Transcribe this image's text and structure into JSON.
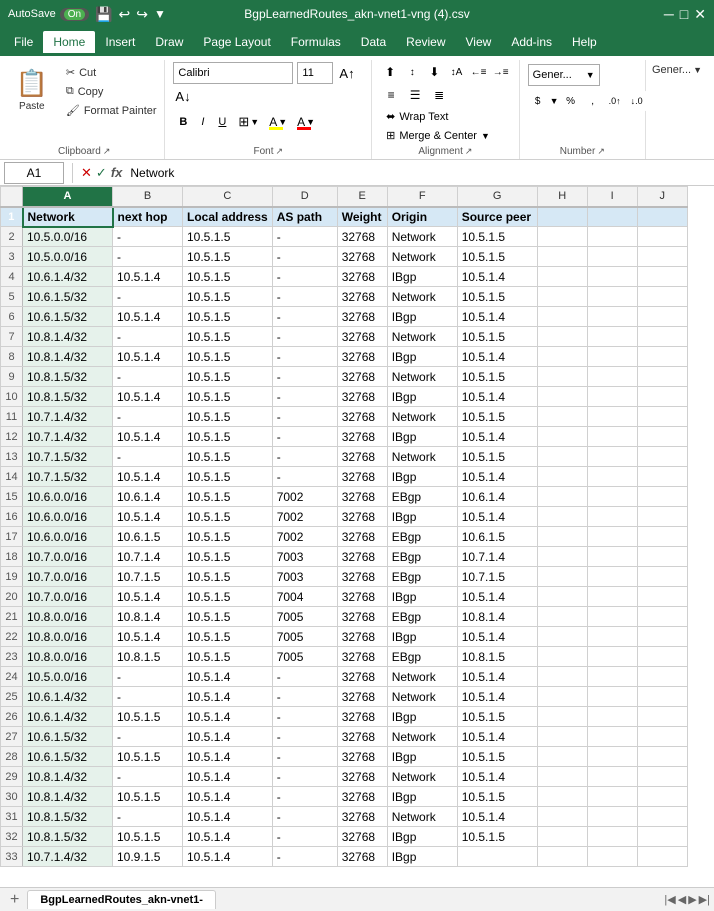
{
  "titleBar": {
    "autosave": "AutoSave",
    "on": "On",
    "title": "BgpLearnedRoutes_akn-vnet1-vng (4).csv",
    "icons": [
      "save",
      "undo",
      "redo",
      "customize"
    ]
  },
  "menuBar": {
    "items": [
      "File",
      "Home",
      "Insert",
      "Draw",
      "Page Layout",
      "Formulas",
      "Data",
      "Review",
      "View",
      "Add-ins",
      "Help"
    ],
    "active": "Home"
  },
  "ribbon": {
    "clipboard": {
      "label": "Clipboard",
      "paste_label": "Paste",
      "cut_label": "Cut",
      "copy_label": "Copy",
      "format_painter_label": "Format Painter"
    },
    "font": {
      "label": "Font",
      "name": "Calibri",
      "size": "11",
      "bold": "B",
      "italic": "I",
      "underline": "U",
      "border_label": "Border",
      "fill_label": "A",
      "fill_color": "#FFFF00",
      "font_color": "#FF0000"
    },
    "alignment": {
      "label": "Alignment",
      "wrap_text": "Wrap Text",
      "merge_center": "Merge & Center"
    },
    "number": {
      "label": "Number",
      "general_label": "Gener..."
    }
  },
  "formulaBar": {
    "cell_ref": "A1",
    "formula_value": "Network"
  },
  "columns": {
    "headers": [
      "",
      "A",
      "B",
      "C",
      "D",
      "E",
      "F",
      "G",
      "H",
      "I",
      "J"
    ],
    "widths": [
      22,
      90,
      70,
      80,
      70,
      55,
      75,
      80,
      55,
      55,
      55
    ]
  },
  "rows": [
    {
      "row": 1,
      "A": "Network",
      "B": "next hop",
      "C": "Local address",
      "D": "AS path",
      "E": "Weight",
      "F": "Origin",
      "G": "Source peer"
    },
    {
      "row": 2,
      "A": "10.5.0.0/16",
      "B": "-",
      "C": "10.5.1.5",
      "D": "-",
      "E": "32768",
      "F": "Network",
      "G": "10.5.1.5"
    },
    {
      "row": 3,
      "A": "10.5.0.0/16",
      "B": "-",
      "C": "10.5.1.5",
      "D": "-",
      "E": "32768",
      "F": "Network",
      "G": "10.5.1.5"
    },
    {
      "row": 4,
      "A": "10.6.1.4/32",
      "B": "10.5.1.4",
      "C": "10.5.1.5",
      "D": "-",
      "E": "32768",
      "F": "IBgp",
      "G": "10.5.1.4"
    },
    {
      "row": 5,
      "A": "10.6.1.5/32",
      "B": "-",
      "C": "10.5.1.5",
      "D": "-",
      "E": "32768",
      "F": "Network",
      "G": "10.5.1.5"
    },
    {
      "row": 6,
      "A": "10.6.1.5/32",
      "B": "10.5.1.4",
      "C": "10.5.1.5",
      "D": "-",
      "E": "32768",
      "F": "IBgp",
      "G": "10.5.1.4"
    },
    {
      "row": 7,
      "A": "10.8.1.4/32",
      "B": "-",
      "C": "10.5.1.5",
      "D": "-",
      "E": "32768",
      "F": "Network",
      "G": "10.5.1.5"
    },
    {
      "row": 8,
      "A": "10.8.1.4/32",
      "B": "10.5.1.4",
      "C": "10.5.1.5",
      "D": "-",
      "E": "32768",
      "F": "IBgp",
      "G": "10.5.1.4"
    },
    {
      "row": 9,
      "A": "10.8.1.5/32",
      "B": "-",
      "C": "10.5.1.5",
      "D": "-",
      "E": "32768",
      "F": "Network",
      "G": "10.5.1.5"
    },
    {
      "row": 10,
      "A": "10.8.1.5/32",
      "B": "10.5.1.4",
      "C": "10.5.1.5",
      "D": "-",
      "E": "32768",
      "F": "IBgp",
      "G": "10.5.1.4"
    },
    {
      "row": 11,
      "A": "10.7.1.4/32",
      "B": "-",
      "C": "10.5.1.5",
      "D": "-",
      "E": "32768",
      "F": "Network",
      "G": "10.5.1.5"
    },
    {
      "row": 12,
      "A": "10.7.1.4/32",
      "B": "10.5.1.4",
      "C": "10.5.1.5",
      "D": "-",
      "E": "32768",
      "F": "IBgp",
      "G": "10.5.1.4"
    },
    {
      "row": 13,
      "A": "10.7.1.5/32",
      "B": "-",
      "C": "10.5.1.5",
      "D": "-",
      "E": "32768",
      "F": "Network",
      "G": "10.5.1.5"
    },
    {
      "row": 14,
      "A": "10.7.1.5/32",
      "B": "10.5.1.4",
      "C": "10.5.1.5",
      "D": "-",
      "E": "32768",
      "F": "IBgp",
      "G": "10.5.1.4"
    },
    {
      "row": 15,
      "A": "10.6.0.0/16",
      "B": "10.6.1.4",
      "C": "10.5.1.5",
      "D": "7002",
      "E": "32768",
      "F": "EBgp",
      "G": "10.6.1.4"
    },
    {
      "row": 16,
      "A": "10.6.0.0/16",
      "B": "10.5.1.4",
      "C": "10.5.1.5",
      "D": "7002",
      "E": "32768",
      "F": "IBgp",
      "G": "10.5.1.4"
    },
    {
      "row": 17,
      "A": "10.6.0.0/16",
      "B": "10.6.1.5",
      "C": "10.5.1.5",
      "D": "7002",
      "E": "32768",
      "F": "EBgp",
      "G": "10.6.1.5"
    },
    {
      "row": 18,
      "A": "10.7.0.0/16",
      "B": "10.7.1.4",
      "C": "10.5.1.5",
      "D": "7003",
      "E": "32768",
      "F": "EBgp",
      "G": "10.7.1.4"
    },
    {
      "row": 19,
      "A": "10.7.0.0/16",
      "B": "10.7.1.5",
      "C": "10.5.1.5",
      "D": "7003",
      "E": "32768",
      "F": "EBgp",
      "G": "10.7.1.5"
    },
    {
      "row": 20,
      "A": "10.7.0.0/16",
      "B": "10.5.1.4",
      "C": "10.5.1.5",
      "D": "7004",
      "E": "32768",
      "F": "IBgp",
      "G": "10.5.1.4"
    },
    {
      "row": 21,
      "A": "10.8.0.0/16",
      "B": "10.8.1.4",
      "C": "10.5.1.5",
      "D": "7005",
      "E": "32768",
      "F": "EBgp",
      "G": "10.8.1.4"
    },
    {
      "row": 22,
      "A": "10.8.0.0/16",
      "B": "10.5.1.4",
      "C": "10.5.1.5",
      "D": "7005",
      "E": "32768",
      "F": "IBgp",
      "G": "10.5.1.4"
    },
    {
      "row": 23,
      "A": "10.8.0.0/16",
      "B": "10.8.1.5",
      "C": "10.5.1.5",
      "D": "7005",
      "E": "32768",
      "F": "EBgp",
      "G": "10.8.1.5"
    },
    {
      "row": 24,
      "A": "10.5.0.0/16",
      "B": "-",
      "C": "10.5.1.4",
      "D": "-",
      "E": "32768",
      "F": "Network",
      "G": "10.5.1.4"
    },
    {
      "row": 25,
      "A": "10.6.1.4/32",
      "B": "-",
      "C": "10.5.1.4",
      "D": "-",
      "E": "32768",
      "F": "Network",
      "G": "10.5.1.4"
    },
    {
      "row": 26,
      "A": "10.6.1.4/32",
      "B": "10.5.1.5",
      "C": "10.5.1.4",
      "D": "-",
      "E": "32768",
      "F": "IBgp",
      "G": "10.5.1.5"
    },
    {
      "row": 27,
      "A": "10.6.1.5/32",
      "B": "-",
      "C": "10.5.1.4",
      "D": "-",
      "E": "32768",
      "F": "Network",
      "G": "10.5.1.4"
    },
    {
      "row": 28,
      "A": "10.6.1.5/32",
      "B": "10.5.1.5",
      "C": "10.5.1.4",
      "D": "-",
      "E": "32768",
      "F": "IBgp",
      "G": "10.5.1.5"
    },
    {
      "row": 29,
      "A": "10.8.1.4/32",
      "B": "-",
      "C": "10.5.1.4",
      "D": "-",
      "E": "32768",
      "F": "Network",
      "G": "10.5.1.4"
    },
    {
      "row": 30,
      "A": "10.8.1.4/32",
      "B": "10.5.1.5",
      "C": "10.5.1.4",
      "D": "-",
      "E": "32768",
      "F": "IBgp",
      "G": "10.5.1.5"
    },
    {
      "row": 31,
      "A": "10.8.1.5/32",
      "B": "-",
      "C": "10.5.1.4",
      "D": "-",
      "E": "32768",
      "F": "Network",
      "G": "10.5.1.4"
    },
    {
      "row": 32,
      "A": "10.8.1.5/32",
      "B": "10.5.1.5",
      "C": "10.5.1.4",
      "D": "-",
      "E": "32768",
      "F": "IBgp",
      "G": "10.5.1.5"
    },
    {
      "row": 33,
      "A": "10.7.1.4/32",
      "B": "10.9.1.5",
      "C": "10.5.1.4",
      "D": "-",
      "E": "32768",
      "F": "IBgp",
      "G": ""
    }
  ],
  "sheetTab": {
    "name": "BgpLearnedRoutes_akn-vnet1-",
    "active": true
  }
}
